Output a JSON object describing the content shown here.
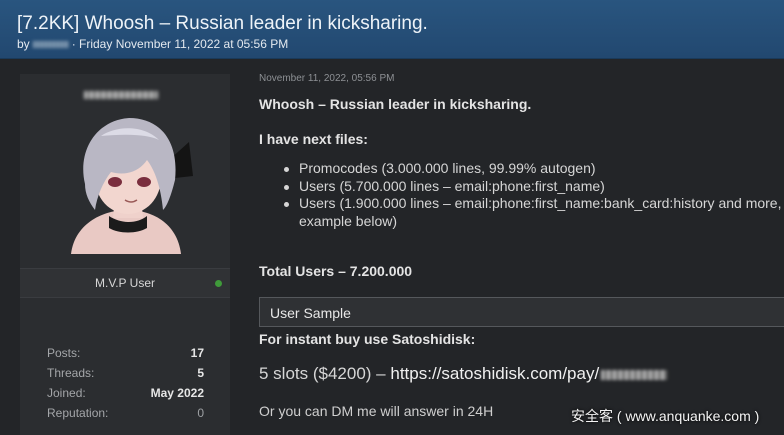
{
  "thread": {
    "title": "[7.2KK] Whoosh – Russian leader in kicksharing.",
    "by": "by",
    "date": "· Friday November 11, 2022 at 05:56 PM"
  },
  "author": {
    "rank": "M.V.P User",
    "online_color": "#3f9a3a",
    "stats": [
      {
        "key": "Posts:",
        "value": "17"
      },
      {
        "key": "Threads:",
        "value": "5"
      },
      {
        "key": "Joined:",
        "value": "May 2022"
      },
      {
        "key": "Reputation:",
        "value": "0"
      }
    ]
  },
  "post": {
    "timestamp": "November 11, 2022, 05:56 PM",
    "headline": "Whoosh – Russian leader in kicksharing.",
    "files_heading": "I have next files:",
    "files": [
      "Promocodes (3.000.000 lines, 99.99% autogen)",
      "Users (5.700.000 lines – email:phone:first_name)",
      "Users (1.900.000 lines – email:phone:first_name:bank_card:history and more, example below)"
    ],
    "total": "Total Users – 7.200.000",
    "spoiler_label": "User Sample",
    "buy_heading": "For instant buy use Satoshidisk:",
    "slots_text": "5 slots ($4200) – ",
    "link_text": "https://satoshidisk.com/pay/",
    "dm_text": "Or you can DM me will answer in 24H"
  },
  "watermark": "安全客 ( www.anquanke.com )",
  "colors": {
    "header_bg": "#224870",
    "page_bg": "#232528",
    "sidebar_bg": "#2b2d30"
  }
}
